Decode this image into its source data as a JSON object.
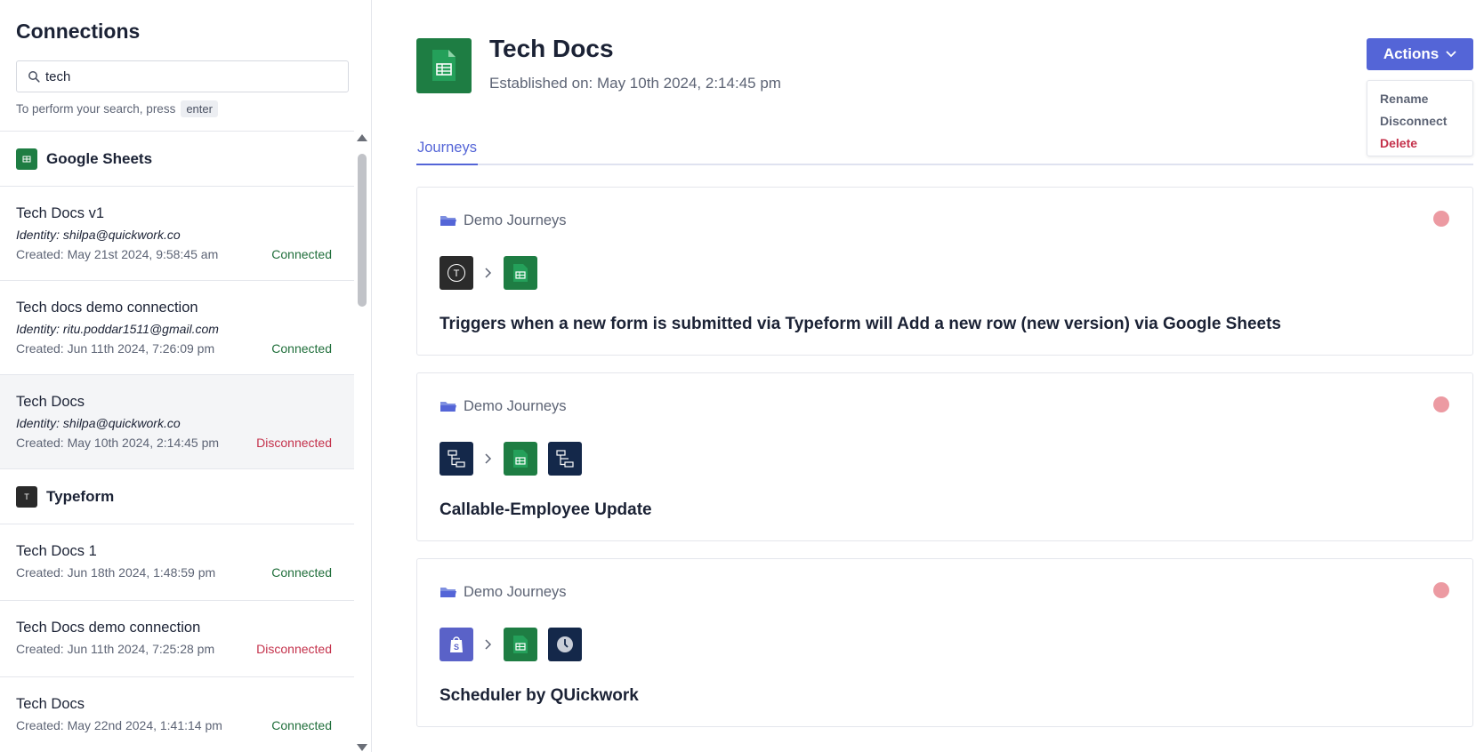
{
  "sidebar": {
    "title": "Connections",
    "search": {
      "value": "tech",
      "placeholder": ""
    },
    "hint": {
      "text": "To perform your search, press",
      "key": "enter"
    },
    "groups": [
      {
        "name": "Google Sheets",
        "icon": "google-sheets-icon",
        "items": [
          {
            "name": "Tech Docs v1",
            "identity": "Identity: shilpa@quickwork.co",
            "created": "Created: May 21st 2024, 9:58:45 am",
            "status": "Connected"
          },
          {
            "name": "Tech docs demo connection",
            "identity": "Identity: ritu.poddar1511@gmail.com",
            "created": "Created: Jun 11th 2024, 7:26:09 pm",
            "status": "Connected"
          },
          {
            "name": "Tech Docs",
            "identity": "Identity: shilpa@quickwork.co",
            "created": "Created: May 10th 2024, 2:14:45 pm",
            "status": "Disconnected"
          }
        ]
      },
      {
        "name": "Typeform",
        "icon": "typeform-icon",
        "items": [
          {
            "name": "Tech Docs 1",
            "created": "Created: Jun 18th 2024, 1:48:59 pm",
            "status": "Connected"
          },
          {
            "name": "Tech Docs demo connection",
            "created": "Created: Jun 11th 2024, 7:25:28 pm",
            "status": "Disconnected"
          },
          {
            "name": "Tech Docs",
            "created": "Created: May 22nd 2024, 1:41:14 pm",
            "status": "Connected"
          }
        ]
      }
    ]
  },
  "main": {
    "title": "Tech Docs",
    "established": "Established on: May 10th 2024, 2:14:45 pm",
    "actions": {
      "label": "Actions",
      "menu": [
        "Rename",
        "Disconnect",
        "Delete"
      ]
    },
    "tabs": [
      "Journeys"
    ],
    "journeys": [
      {
        "folder": "Demo Journeys",
        "steps": [
          "typeform-icon",
          "google-sheets-icon"
        ],
        "description": "Triggers when a new form is submitted via Typeform will Add a new row (new version) via Google Sheets"
      },
      {
        "folder": "Demo Journeys",
        "steps": [
          "callable-flow-icon",
          "google-sheets-icon",
          "callable-flow-icon"
        ],
        "description": "Callable-Employee Update"
      },
      {
        "folder": "Demo Journeys",
        "steps": [
          "shopify-icon",
          "google-sheets-icon",
          "clock-icon"
        ],
        "description": "Scheduler by QUickwork"
      }
    ]
  },
  "colors": {
    "accent": "#5465d7",
    "connected": "#1f6e3a",
    "disconnected": "#c4314b",
    "sheets_green": "#1e7d43",
    "status_dot": "#ec9aa2"
  }
}
